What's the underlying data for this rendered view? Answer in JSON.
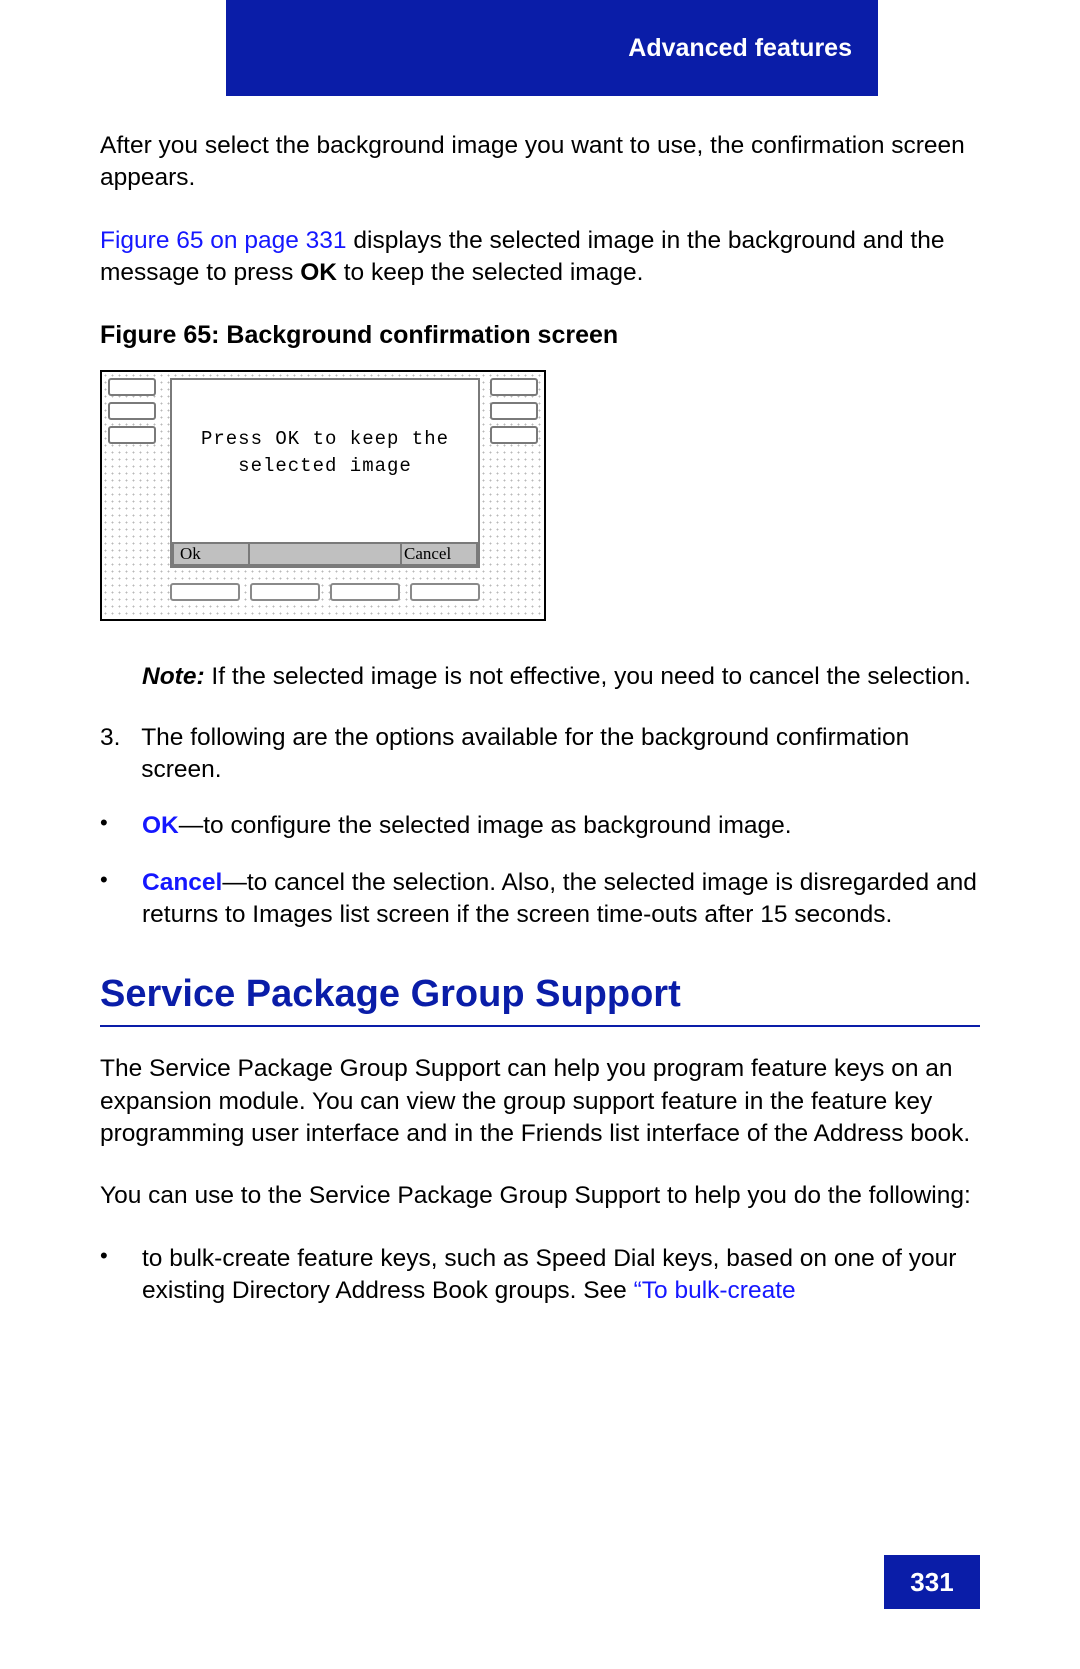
{
  "header": {
    "section_title": "Advanced features"
  },
  "intro": {
    "p1": "After you select the background image you want to use, the confirmation screen appears.",
    "p2_link": "Figure 65 on page 331",
    "p2a": " displays the selected image in the background and the message to press ",
    "p2_ok": "OK",
    "p2b": " to keep the selected image."
  },
  "figure": {
    "caption": "Figure 65: Background confirmation screen",
    "message_line1": "Press OK to keep the",
    "message_line2": "selected image",
    "ok_label": "Ok",
    "cancel_label": "Cancel"
  },
  "note": {
    "label": "Note:",
    "text": "  If the selected image is not effective, you need to cancel the selection."
  },
  "step3": {
    "mark": "3.",
    "text": "The following are the options available for the background confirmation screen."
  },
  "options": {
    "ok": {
      "label": "OK",
      "text": "—to configure the selected image as background image."
    },
    "cancel": {
      "label": "Cancel",
      "text": "—to cancel the selection. Also, the selected image is disregarded and returns to Images list screen if the screen time-outs after 15 seconds."
    }
  },
  "section": {
    "title": "Service Package Group Support",
    "p1": "The Service Package Group Support can help you program feature keys on an expansion module. You can view the group support feature in the feature key programming user interface and in the Friends list interface of the Address book.",
    "p2": "You can use to the Service Package Group Support to help you do the following:",
    "bullet1_a": "to bulk-create feature keys, such as Speed Dial keys, based on one of your existing Directory Address Book groups. See ",
    "bullet1_link": "“To bulk-create"
  },
  "page_number": "331"
}
